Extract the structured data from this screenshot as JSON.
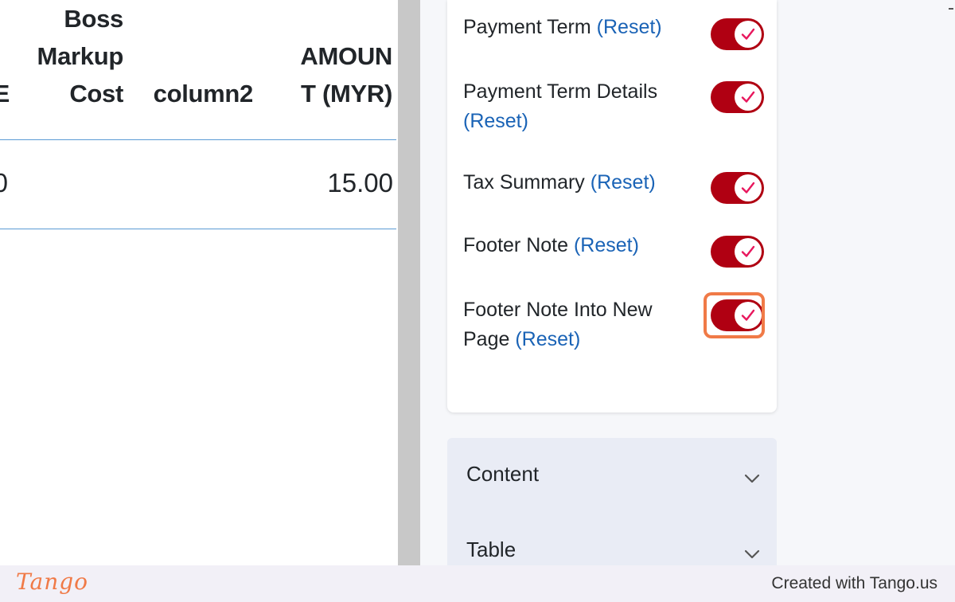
{
  "table": {
    "headers": {
      "cut_partial": "E",
      "boss_markup_cost_lines": [
        "Boss",
        "Markup",
        "Cost"
      ],
      "column2": "column2",
      "amount_lines": [
        "AMOUN",
        "T (MYR)"
      ]
    },
    "rows": [
      {
        "cut_partial": "0",
        "amount": "15.00"
      }
    ]
  },
  "settings": {
    "reset_label": "(Reset)",
    "options": [
      {
        "label": "Payment Term",
        "enabled": true
      },
      {
        "label": "Payment Term Details",
        "enabled": true
      },
      {
        "label": "Tax Summary",
        "enabled": true
      },
      {
        "label": "Footer Note",
        "enabled": true
      },
      {
        "label": "Footer Note Into New Page",
        "enabled": true,
        "highlighted": true
      }
    ],
    "colors": {
      "toggle_on": "#b00012",
      "check": "#e8175d",
      "reset_link": "#1a63b6",
      "highlight": "#f07a47"
    }
  },
  "accordion": [
    {
      "label": "Content",
      "icon": "chevron-down-icon"
    },
    {
      "label": "Table",
      "icon": "chevron-down-icon"
    }
  ],
  "footer": {
    "logo": "Tango",
    "credit": "Created with Tango.us"
  }
}
